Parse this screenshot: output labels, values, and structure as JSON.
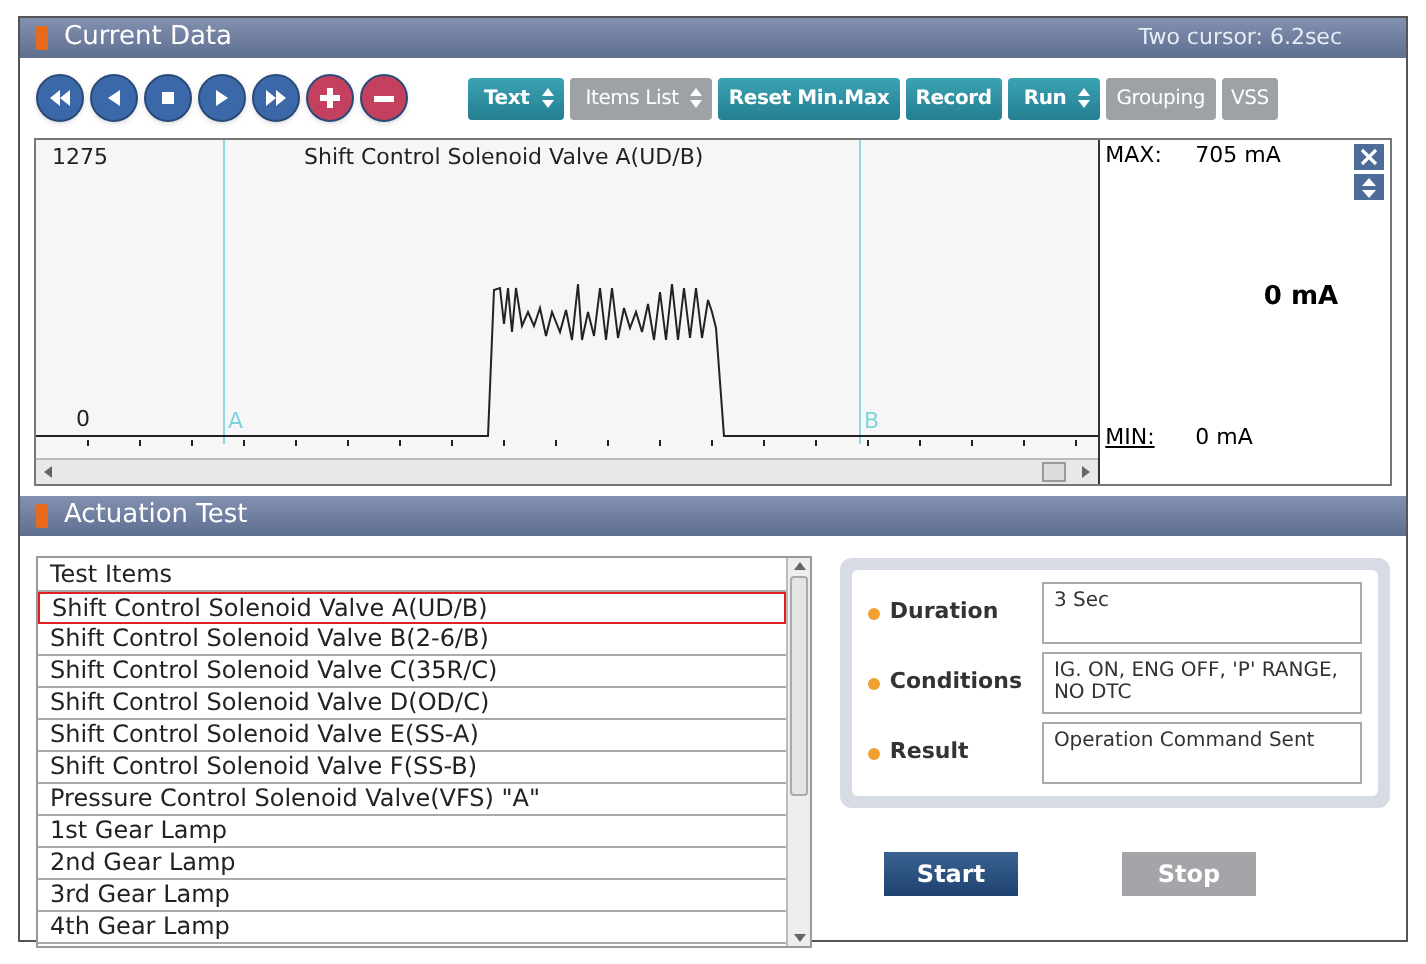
{
  "current_data": {
    "title": "Current Data",
    "cursor_info": "Two cursor: 6.2sec"
  },
  "toolbar": {
    "buttons": [
      {
        "label": "Text",
        "dropdown": true,
        "disabled": false
      },
      {
        "label": "Items List",
        "dropdown": true,
        "disabled": true
      },
      {
        "label": "Reset Min.Max",
        "dropdown": false,
        "disabled": false
      },
      {
        "label": "Record",
        "dropdown": false,
        "disabled": false
      },
      {
        "label": "Run",
        "dropdown": true,
        "disabled": false
      },
      {
        "label": "Grouping",
        "dropdown": false,
        "disabled": true
      },
      {
        "label": "VSS",
        "dropdown": false,
        "disabled": true
      }
    ]
  },
  "graph": {
    "y_top_label": "1275",
    "y_bottom_label": "0",
    "title": "Shift Control Solenoid Valve A(UD/B)",
    "cursor_a": "A",
    "cursor_b": "B",
    "max_label": "MAX:",
    "max_value": "705 mA",
    "current_value": "0 mA",
    "min_label": "MIN:",
    "min_value": "0 mA"
  },
  "actuation_test": {
    "title": "Actuation Test",
    "list_header": "Test Items",
    "items": [
      {
        "label": "Shift Control Solenoid Valve A(UD/B)",
        "selected": true
      },
      {
        "label": "Shift Control Solenoid Valve B(2-6/B)",
        "selected": false
      },
      {
        "label": "Shift Control Solenoid Valve C(35R/C)",
        "selected": false
      },
      {
        "label": "Shift Control Solenoid Valve D(OD/C)",
        "selected": false
      },
      {
        "label": "Shift Control Solenoid Valve E(SS-A)",
        "selected": false
      },
      {
        "label": "Shift Control Solenoid Valve F(SS-B)",
        "selected": false
      },
      {
        "label": "Pressure Control Solenoid Valve(VFS) \"A\"",
        "selected": false
      },
      {
        "label": "1st Gear Lamp",
        "selected": false
      },
      {
        "label": "2nd Gear Lamp",
        "selected": false
      },
      {
        "label": "3rd Gear Lamp",
        "selected": false
      },
      {
        "label": "4th Gear Lamp",
        "selected": false
      }
    ],
    "details": [
      {
        "label": "Duration",
        "value": "3 Sec"
      },
      {
        "label": "Conditions",
        "value": "IG. ON, ENG OFF, 'P' RANGE, NO DTC"
      },
      {
        "label": "Result",
        "value": "Operation Command Sent"
      }
    ],
    "buttons": [
      {
        "label": "Start",
        "disabled": false
      },
      {
        "label": "Stop",
        "disabled": true
      }
    ]
  }
}
